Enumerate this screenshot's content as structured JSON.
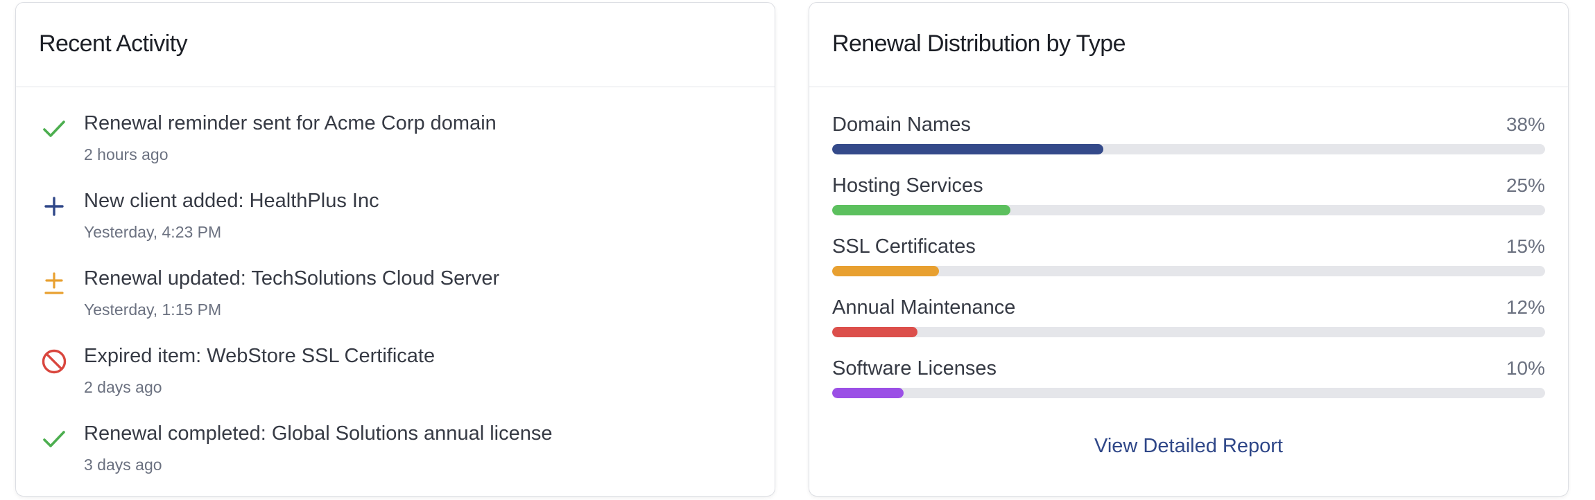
{
  "activity": {
    "title": "Recent Activity",
    "items": [
      {
        "icon": "check-icon",
        "color": "#4cae4f",
        "text": "Renewal reminder sent for Acme Corp domain",
        "time": "2 hours ago"
      },
      {
        "icon": "plus-icon",
        "color": "#2f4788",
        "text": "New client added: HealthPlus Inc",
        "time": "Yesterday, 4:23 PM"
      },
      {
        "icon": "plus-minus-icon",
        "color": "#e8a030",
        "text": "Renewal updated: TechSolutions Cloud Server",
        "time": "Yesterday, 1:15 PM"
      },
      {
        "icon": "blocked-icon",
        "color": "#d9463e",
        "text": "Expired item: WebStore SSL Certificate",
        "time": "2 days ago"
      },
      {
        "icon": "check-icon",
        "color": "#4cae4f",
        "text": "Renewal completed: Global Solutions annual license",
        "time": "3 days ago"
      }
    ]
  },
  "distribution": {
    "title": "Renewal Distribution by Type",
    "rows": [
      {
        "label": "Domain Names",
        "percent_label": "38%",
        "percent": 38,
        "color": "#344a8a"
      },
      {
        "label": "Hosting Services",
        "percent_label": "25%",
        "percent": 25,
        "color": "#5cc05e"
      },
      {
        "label": "SSL Certificates",
        "percent_label": "15%",
        "percent": 15,
        "color": "#e8a030"
      },
      {
        "label": "Annual Maintenance",
        "percent_label": "12%",
        "percent": 12,
        "color": "#dc4f4b"
      },
      {
        "label": "Software Licenses",
        "percent_label": "10%",
        "percent": 10,
        "color": "#9b4fe6"
      }
    ],
    "link_label": "View Detailed Report"
  }
}
